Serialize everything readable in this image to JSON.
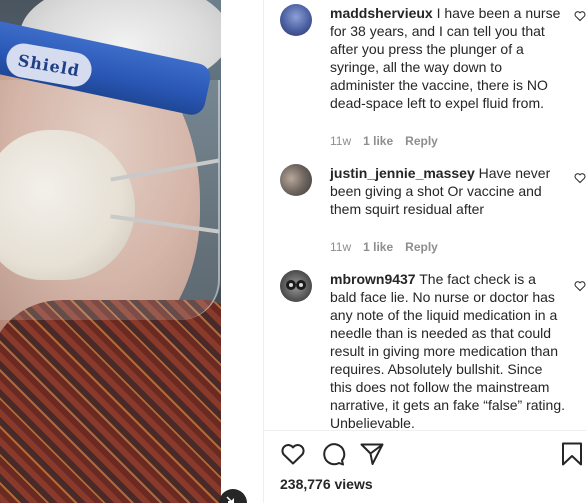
{
  "media": {
    "shield_text": "Shield",
    "mute_icon": "speaker-muted-icon"
  },
  "comments": [
    {
      "username": "maddshervieux",
      "text": "I have been a nurse for 38 years, and I can tell you that after you press the plunger of a syringe, all the way down to administer the vaccine, there is NO dead-space left to expel fluid from.",
      "age": "11w",
      "likes": "1 like",
      "reply": "Reply",
      "avatar_color": "#3a4f8f"
    },
    {
      "username": "justin_jennie_massey",
      "text": "Have never been giving a shot Or vaccine and them squirt residual after",
      "age": "11w",
      "likes": "1 like",
      "reply": "Reply",
      "avatar_color": "#6f6660"
    },
    {
      "username": "mbrown9437",
      "text": "The fact check is a bald face lie. No nurse or doctor has any note of the liquid medication in a needle than is needed as that could result in giving more medication than requires. Absolutely bullshit. Since this does not follow the mainstream narrative, it gets an fake “false” rating. Unbelievable.",
      "age": "",
      "likes": "",
      "reply": "",
      "avatar_color": "#5a5a5a"
    }
  ],
  "actions": {
    "like_icon": "heart-icon",
    "comment_icon": "comment-icon",
    "share_icon": "paper-plane-icon",
    "save_icon": "bookmark-icon"
  },
  "views": "238,776 views"
}
